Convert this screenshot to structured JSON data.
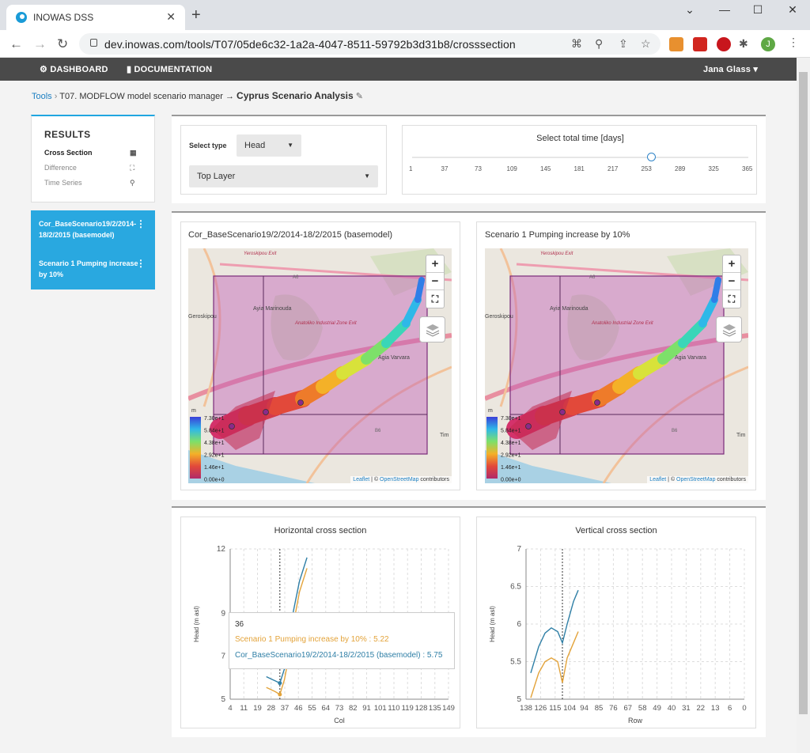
{
  "browser": {
    "tab_title": "INOWAS DSS",
    "url": "dev.inowas.com/tools/T07/05de6c32-1a2a-4047-8511-59792b3d31b8/crosssection",
    "profile_initial": "J"
  },
  "nav": {
    "dashboard": "DASHBOARD",
    "documentation": "DOCUMENTATION",
    "user": "Jana Glass"
  },
  "breadcrumb": {
    "tools": "Tools",
    "tool": "T07. MODFLOW model scenario manager",
    "sep": "→",
    "title": "Cyprus Scenario Analysis"
  },
  "results": {
    "heading": "RESULTS",
    "items": [
      "Cross Section",
      "Difference",
      "Time Series"
    ]
  },
  "scenarios": [
    "Cor_BaseScenario19/2/2014-18/2/2015 (basemodel)",
    "Scenario 1 Pumping increase by 10%"
  ],
  "controls": {
    "select_type_label": "Select type",
    "type_value": "Head",
    "layer_value": "Top Layer",
    "time_title": "Select total time [days]",
    "time_ticks": [
      "1",
      "37",
      "73",
      "109",
      "145",
      "181",
      "217",
      "253",
      "289",
      "325",
      "365"
    ],
    "selected_time": "253"
  },
  "maps": [
    {
      "title": "Cor_BaseScenario19/2/2014-18/2/2015 (basemodel)"
    },
    {
      "title": "Scenario 1 Pumping increase by 10%"
    }
  ],
  "map_labels": {
    "place1": "Ayia Marinouda",
    "place2": "Anatoliko Industrial Zone Exit",
    "place3": "Agia Varvara",
    "place4": "Yeroskipou Exit",
    "place5": "Geroskipou",
    "place6": "Tim",
    "road1": "A6",
    "road2": "B6",
    "legend_unit": "m",
    "legend_values": [
      "7.30e+1",
      "5.84e+1",
      "4.38e+1",
      "2.92e+1",
      "1.46e+1",
      "0.00e+0"
    ],
    "attr_leaflet": "Leaflet",
    "attr_osm": "OpenStreetMap",
    "attr_rest": "contributors",
    "zoom_in": "+",
    "zoom_out": "−"
  },
  "colors": {
    "accent": "#29a8e0",
    "series_base": "#2f7fa6",
    "series_scen": "#e3a33a"
  },
  "chart_data": [
    {
      "type": "line",
      "title": "Horizontal cross section",
      "xlabel": "Col",
      "ylabel": "Head (m asl)",
      "ylim": [
        5,
        12
      ],
      "x_ticks": [
        "4",
        "11",
        "19",
        "28",
        "37",
        "46",
        "55",
        "64",
        "73",
        "82",
        "91",
        "101",
        "110",
        "119",
        "128",
        "135",
        "149"
      ],
      "y_ticks": [
        "5",
        "7",
        "9",
        "12"
      ],
      "marker_x": "37",
      "series": [
        {
          "name": "Cor_BaseScenario19/2/2014-18/2/2015 (basemodel)",
          "color": "#2f7fa6",
          "x": [
            28,
            31,
            34,
            37,
            40,
            43,
            46,
            50,
            55
          ],
          "y": [
            6.05,
            5.95,
            5.85,
            5.75,
            6.4,
            7.6,
            9.1,
            10.5,
            11.6
          ]
        },
        {
          "name": "Scenario 1 Pumping increase by 10%",
          "color": "#e3a33a",
          "x": [
            28,
            31,
            34,
            37,
            40,
            43,
            46,
            50,
            55
          ],
          "y": [
            5.55,
            5.45,
            5.35,
            5.22,
            5.9,
            7.0,
            8.5,
            10.0,
            11.1
          ]
        }
      ],
      "tooltip": {
        "title": "36",
        "rows": [
          "Scenario 1 Pumping increase by 10% : 5.22",
          "Cor_BaseScenario19/2/2014-18/2/2015 (basemodel) : 5.75"
        ]
      }
    },
    {
      "type": "line",
      "title": "Vertical cross section",
      "xlabel": "Row",
      "ylabel": "Head (m asl)",
      "ylim": [
        5,
        7
      ],
      "x_ticks": [
        "138",
        "126",
        "115",
        "104",
        "94",
        "85",
        "76",
        "67",
        "58",
        "49",
        "40",
        "31",
        "22",
        "13",
        "6",
        "0"
      ],
      "y_ticks": [
        "5",
        "5.5",
        "6",
        "6.5",
        "7"
      ],
      "marker_x": "115",
      "series": [
        {
          "name": "Cor_BaseScenario19/2/2014-18/2/2015 (basemodel)",
          "color": "#2f7fa6",
          "x": [
            135,
            130,
            126,
            122,
            118,
            115,
            112,
            108,
            105
          ],
          "y": [
            5.35,
            5.7,
            5.88,
            5.95,
            5.9,
            5.75,
            6.0,
            6.3,
            6.45
          ]
        },
        {
          "name": "Scenario 1 Pumping increase by 10%",
          "color": "#e3a33a",
          "x": [
            135,
            130,
            126,
            122,
            118,
            115,
            112,
            108,
            105
          ],
          "y": [
            5.02,
            5.35,
            5.5,
            5.55,
            5.5,
            5.22,
            5.55,
            5.75,
            5.9
          ]
        }
      ]
    }
  ]
}
